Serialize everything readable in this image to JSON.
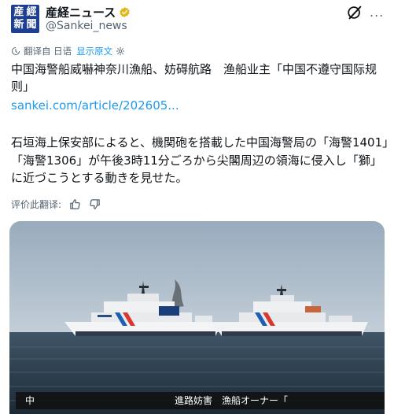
{
  "account": {
    "avatar_chars": [
      "産",
      "經",
      "新",
      "聞"
    ],
    "display_name": "産経ニュース",
    "handle": "@Sankei_news",
    "verified_color": "#e2b719"
  },
  "header": {
    "grok_icon": "grok-icon",
    "more_label": "..."
  },
  "translation": {
    "label": "翻译自 日语",
    "show_original": "显示原文"
  },
  "post": {
    "headline": "中国海警船威嚇神奈川漁船、妨碍航路　渔船业主「中国不遵守国际规则」",
    "link": "sankei.com/article/202605...",
    "body": "石垣海上保安部によると、機関砲を搭載した中国海警局の「海警1401」「海警1306」が午後3時11分ごろから尖閣周辺の領海に侵入し「獅」に近づこうとする動きを見せた。"
  },
  "rating": {
    "label": "评价此翻译:"
  },
  "media": {
    "caption_lead": "中",
    "caption_text": "進路妨害　漁船オーナー「"
  },
  "colors": {
    "link": "#1d9bf0",
    "secondary_text": "#536471",
    "avatar_bg": "#1d3f8f"
  }
}
